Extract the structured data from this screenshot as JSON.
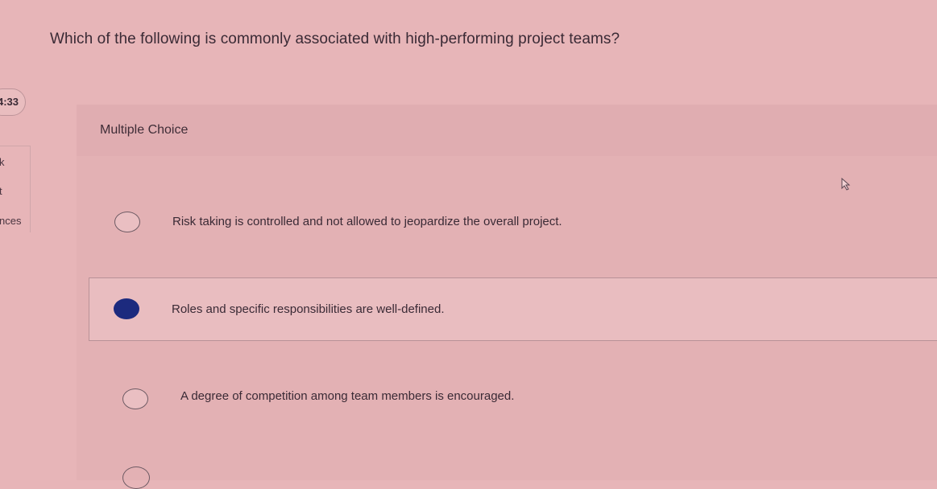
{
  "question": {
    "text": "Which of the following is commonly associated with high-performing project teams?"
  },
  "timer": {
    "text": "4:33"
  },
  "left_panel": {
    "item1": "k",
    "item2": "t",
    "item3": "nces"
  },
  "question_type": {
    "label": "Multiple Choice"
  },
  "options": [
    {
      "text": "Risk taking is controlled and not allowed to jeopardize the overall project.",
      "selected": false
    },
    {
      "text": "Roles and specific responsibilities are well-defined.",
      "selected": true
    },
    {
      "text": "A degree of competition among team members is encouraged.",
      "selected": false
    }
  ],
  "colors": {
    "background": "#e7b5b8",
    "selected_radio": "#1c2a7e",
    "selected_row": "#e9bdc0"
  }
}
